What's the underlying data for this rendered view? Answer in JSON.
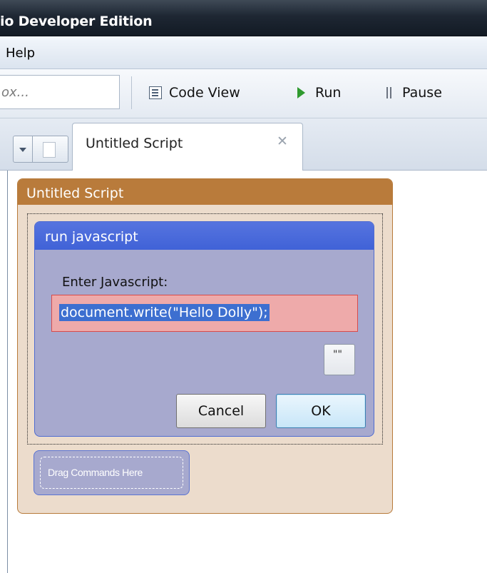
{
  "window": {
    "title": "io Developer Edition"
  },
  "menu": {
    "items": [
      "Help"
    ]
  },
  "toolbar": {
    "search_placeholder": "ox...",
    "code_view_label": "Code View",
    "run_label": "Run",
    "pause_label": "Pause"
  },
  "tabs": [
    {
      "label": "Untitled Script",
      "close_glyph": "✕"
    }
  ],
  "script": {
    "title": "Untitled Script",
    "command": {
      "title": "run javascript",
      "prompt": "Enter Javascript:",
      "code": "document.write(\"Hello Dolly\");",
      "ellipsis": "\"\"",
      "cancel_label": "Cancel",
      "ok_label": "OK"
    },
    "drop_zone_label": "Drag Commands Here"
  },
  "colors": {
    "script_header": "#b97b3b",
    "command_header": "#4062d7",
    "command_body": "#a7a9ce",
    "input_error_bg": "#eeaaaa",
    "selection": "#3d6fd0"
  }
}
